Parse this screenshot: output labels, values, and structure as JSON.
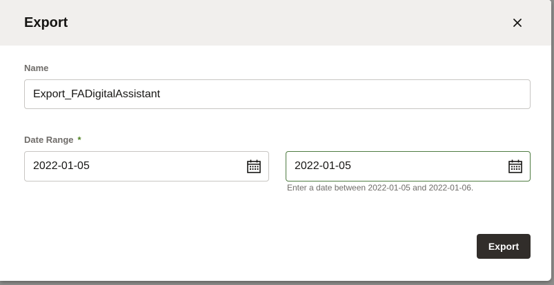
{
  "dialog": {
    "title": "Export",
    "close_icon": "close-icon"
  },
  "form": {
    "name_label": "Name",
    "name_value": "Export_FADigitalAssistant",
    "date_range_label": "Date Range",
    "required_mark": "*",
    "date_from": "2022-01-05",
    "date_to": "2022-01-05",
    "calendar_icon": "calendar-icon",
    "helper_text": "Enter a date between 2022-01-05 and 2022-01-06."
  },
  "footer": {
    "export_label": "Export"
  },
  "colors": {
    "header_bg": "#f1efed",
    "button_bg": "#312d2a",
    "required": "#508223",
    "focus_border": "#4d7a3f"
  }
}
